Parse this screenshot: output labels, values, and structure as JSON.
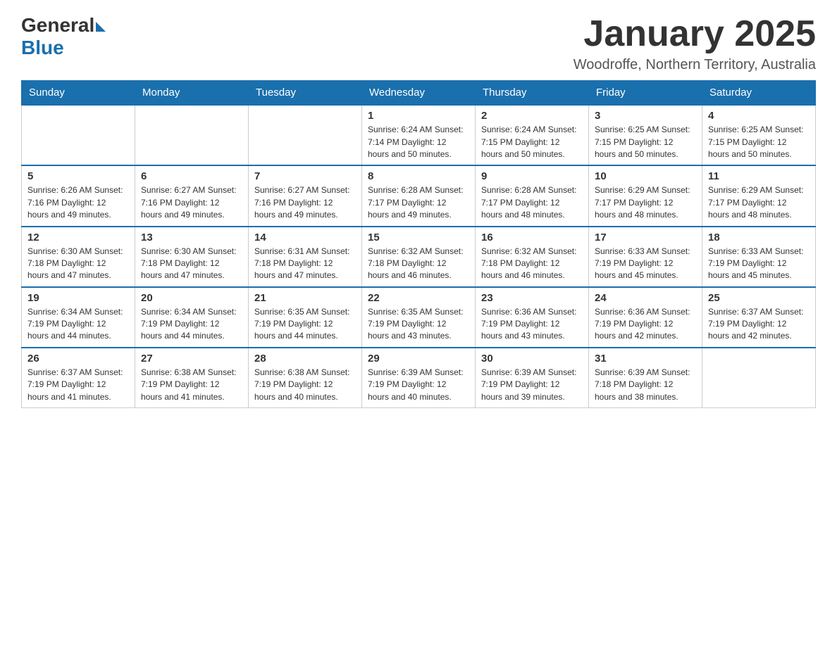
{
  "header": {
    "logo_general": "General",
    "logo_blue": "Blue",
    "month_title": "January 2025",
    "location": "Woodroffe, Northern Territory, Australia"
  },
  "days_of_week": [
    "Sunday",
    "Monday",
    "Tuesday",
    "Wednesday",
    "Thursday",
    "Friday",
    "Saturday"
  ],
  "weeks": [
    [
      {
        "day": "",
        "info": ""
      },
      {
        "day": "",
        "info": ""
      },
      {
        "day": "",
        "info": ""
      },
      {
        "day": "1",
        "info": "Sunrise: 6:24 AM\nSunset: 7:14 PM\nDaylight: 12 hours and 50 minutes."
      },
      {
        "day": "2",
        "info": "Sunrise: 6:24 AM\nSunset: 7:15 PM\nDaylight: 12 hours and 50 minutes."
      },
      {
        "day": "3",
        "info": "Sunrise: 6:25 AM\nSunset: 7:15 PM\nDaylight: 12 hours and 50 minutes."
      },
      {
        "day": "4",
        "info": "Sunrise: 6:25 AM\nSunset: 7:15 PM\nDaylight: 12 hours and 50 minutes."
      }
    ],
    [
      {
        "day": "5",
        "info": "Sunrise: 6:26 AM\nSunset: 7:16 PM\nDaylight: 12 hours and 49 minutes."
      },
      {
        "day": "6",
        "info": "Sunrise: 6:27 AM\nSunset: 7:16 PM\nDaylight: 12 hours and 49 minutes."
      },
      {
        "day": "7",
        "info": "Sunrise: 6:27 AM\nSunset: 7:16 PM\nDaylight: 12 hours and 49 minutes."
      },
      {
        "day": "8",
        "info": "Sunrise: 6:28 AM\nSunset: 7:17 PM\nDaylight: 12 hours and 49 minutes."
      },
      {
        "day": "9",
        "info": "Sunrise: 6:28 AM\nSunset: 7:17 PM\nDaylight: 12 hours and 48 minutes."
      },
      {
        "day": "10",
        "info": "Sunrise: 6:29 AM\nSunset: 7:17 PM\nDaylight: 12 hours and 48 minutes."
      },
      {
        "day": "11",
        "info": "Sunrise: 6:29 AM\nSunset: 7:17 PM\nDaylight: 12 hours and 48 minutes."
      }
    ],
    [
      {
        "day": "12",
        "info": "Sunrise: 6:30 AM\nSunset: 7:18 PM\nDaylight: 12 hours and 47 minutes."
      },
      {
        "day": "13",
        "info": "Sunrise: 6:30 AM\nSunset: 7:18 PM\nDaylight: 12 hours and 47 minutes."
      },
      {
        "day": "14",
        "info": "Sunrise: 6:31 AM\nSunset: 7:18 PM\nDaylight: 12 hours and 47 minutes."
      },
      {
        "day": "15",
        "info": "Sunrise: 6:32 AM\nSunset: 7:18 PM\nDaylight: 12 hours and 46 minutes."
      },
      {
        "day": "16",
        "info": "Sunrise: 6:32 AM\nSunset: 7:18 PM\nDaylight: 12 hours and 46 minutes."
      },
      {
        "day": "17",
        "info": "Sunrise: 6:33 AM\nSunset: 7:19 PM\nDaylight: 12 hours and 45 minutes."
      },
      {
        "day": "18",
        "info": "Sunrise: 6:33 AM\nSunset: 7:19 PM\nDaylight: 12 hours and 45 minutes."
      }
    ],
    [
      {
        "day": "19",
        "info": "Sunrise: 6:34 AM\nSunset: 7:19 PM\nDaylight: 12 hours and 44 minutes."
      },
      {
        "day": "20",
        "info": "Sunrise: 6:34 AM\nSunset: 7:19 PM\nDaylight: 12 hours and 44 minutes."
      },
      {
        "day": "21",
        "info": "Sunrise: 6:35 AM\nSunset: 7:19 PM\nDaylight: 12 hours and 44 minutes."
      },
      {
        "day": "22",
        "info": "Sunrise: 6:35 AM\nSunset: 7:19 PM\nDaylight: 12 hours and 43 minutes."
      },
      {
        "day": "23",
        "info": "Sunrise: 6:36 AM\nSunset: 7:19 PM\nDaylight: 12 hours and 43 minutes."
      },
      {
        "day": "24",
        "info": "Sunrise: 6:36 AM\nSunset: 7:19 PM\nDaylight: 12 hours and 42 minutes."
      },
      {
        "day": "25",
        "info": "Sunrise: 6:37 AM\nSunset: 7:19 PM\nDaylight: 12 hours and 42 minutes."
      }
    ],
    [
      {
        "day": "26",
        "info": "Sunrise: 6:37 AM\nSunset: 7:19 PM\nDaylight: 12 hours and 41 minutes."
      },
      {
        "day": "27",
        "info": "Sunrise: 6:38 AM\nSunset: 7:19 PM\nDaylight: 12 hours and 41 minutes."
      },
      {
        "day": "28",
        "info": "Sunrise: 6:38 AM\nSunset: 7:19 PM\nDaylight: 12 hours and 40 minutes."
      },
      {
        "day": "29",
        "info": "Sunrise: 6:39 AM\nSunset: 7:19 PM\nDaylight: 12 hours and 40 minutes."
      },
      {
        "day": "30",
        "info": "Sunrise: 6:39 AM\nSunset: 7:19 PM\nDaylight: 12 hours and 39 minutes."
      },
      {
        "day": "31",
        "info": "Sunrise: 6:39 AM\nSunset: 7:18 PM\nDaylight: 12 hours and 38 minutes."
      },
      {
        "day": "",
        "info": ""
      }
    ]
  ]
}
